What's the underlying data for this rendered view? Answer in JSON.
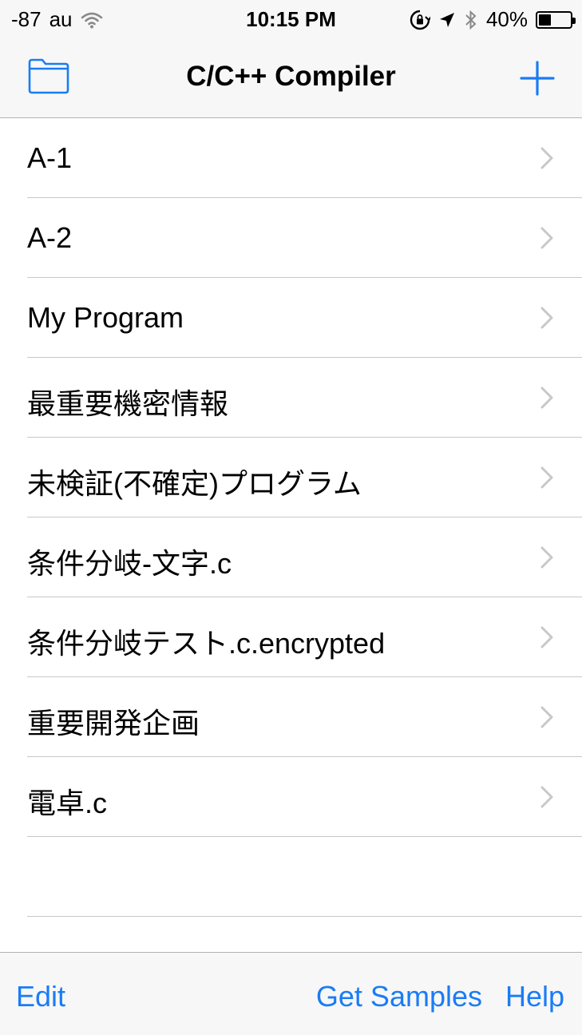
{
  "status_bar": {
    "signal": "-87",
    "carrier": "au",
    "wifi_icon": "wifi-icon",
    "time": "10:15 PM",
    "orientation_lock_icon": "orientation-lock-icon",
    "location_icon": "location-arrow-icon",
    "bluetooth_icon": "bluetooth-icon",
    "battery_percent": "40%",
    "battery_level": 0.4
  },
  "nav": {
    "title": "C/C++ Compiler",
    "folder_icon": "folder-icon",
    "add_icon": "plus-icon"
  },
  "files": [
    {
      "name": "A-1"
    },
    {
      "name": "A-2"
    },
    {
      "name": "My Program"
    },
    {
      "name": "最重要機密情報"
    },
    {
      "name": "未検証(不確定)プログラム"
    },
    {
      "name": "条件分岐-文字.c"
    },
    {
      "name": "条件分岐テスト.c.encrypted"
    },
    {
      "name": "重要開発企画"
    },
    {
      "name": "電卓.c"
    }
  ],
  "toolbar": {
    "edit_label": "Edit",
    "samples_label": "Get Samples",
    "help_label": "Help"
  },
  "colors": {
    "accent": "#1a7cf5",
    "bar_background": "#f7f7f7",
    "separator": "#c8c7cc",
    "chevron": "#c7c7cc"
  }
}
